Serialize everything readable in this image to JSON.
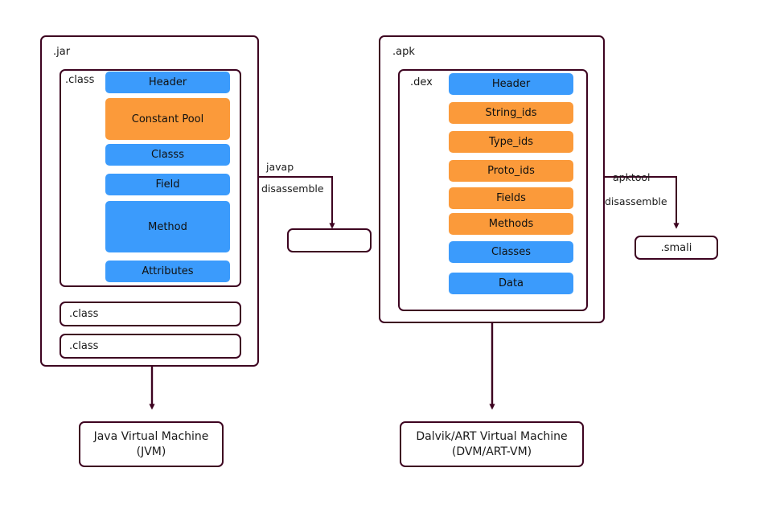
{
  "diagram": {
    "title": "JAR/APK file structure and disassembly flow",
    "stroke_color": "#3d0320",
    "blue": "#3b9bfc",
    "orange": "#fb9a3a"
  },
  "jar": {
    "label": ".jar",
    "class_label": ".class",
    "sections": [
      {
        "name": "Header",
        "color": "blue"
      },
      {
        "name": "Constant Pool",
        "color": "orange"
      },
      {
        "name": "Classs",
        "color": "blue"
      },
      {
        "name": "Field",
        "color": "blue"
      },
      {
        "name": "Method",
        "color": "blue"
      },
      {
        "name": "Attributes",
        "color": "blue"
      }
    ],
    "extra_class_boxes": [
      {
        "label": ".class"
      },
      {
        "label": ".class"
      }
    ]
  },
  "apk": {
    "label": ".apk",
    "dex_label": ".dex",
    "sections": [
      {
        "name": "Header",
        "color": "blue"
      },
      {
        "name": "String_ids",
        "color": "orange"
      },
      {
        "name": "Type_ids",
        "color": "orange"
      },
      {
        "name": "Proto_ids",
        "color": "orange"
      },
      {
        "name": "Fields",
        "color": "orange"
      },
      {
        "name": "Methods",
        "color": "orange"
      },
      {
        "name": "Classes",
        "color": "blue"
      },
      {
        "name": "Data",
        "color": "blue"
      }
    ]
  },
  "edges": {
    "javap": {
      "tool": "javap",
      "action": "disassemble",
      "target_label": ""
    },
    "apktool": {
      "tool": "apktool",
      "action": "disassemble",
      "target_label": ".smali"
    }
  },
  "runtimes": {
    "jvm": {
      "line1": "Java Virtual Machine",
      "line2": "(JVM)"
    },
    "dvm": {
      "line1": "Dalvik/ART Virtual Machine",
      "line2": "(DVM/ART-VM)"
    }
  }
}
